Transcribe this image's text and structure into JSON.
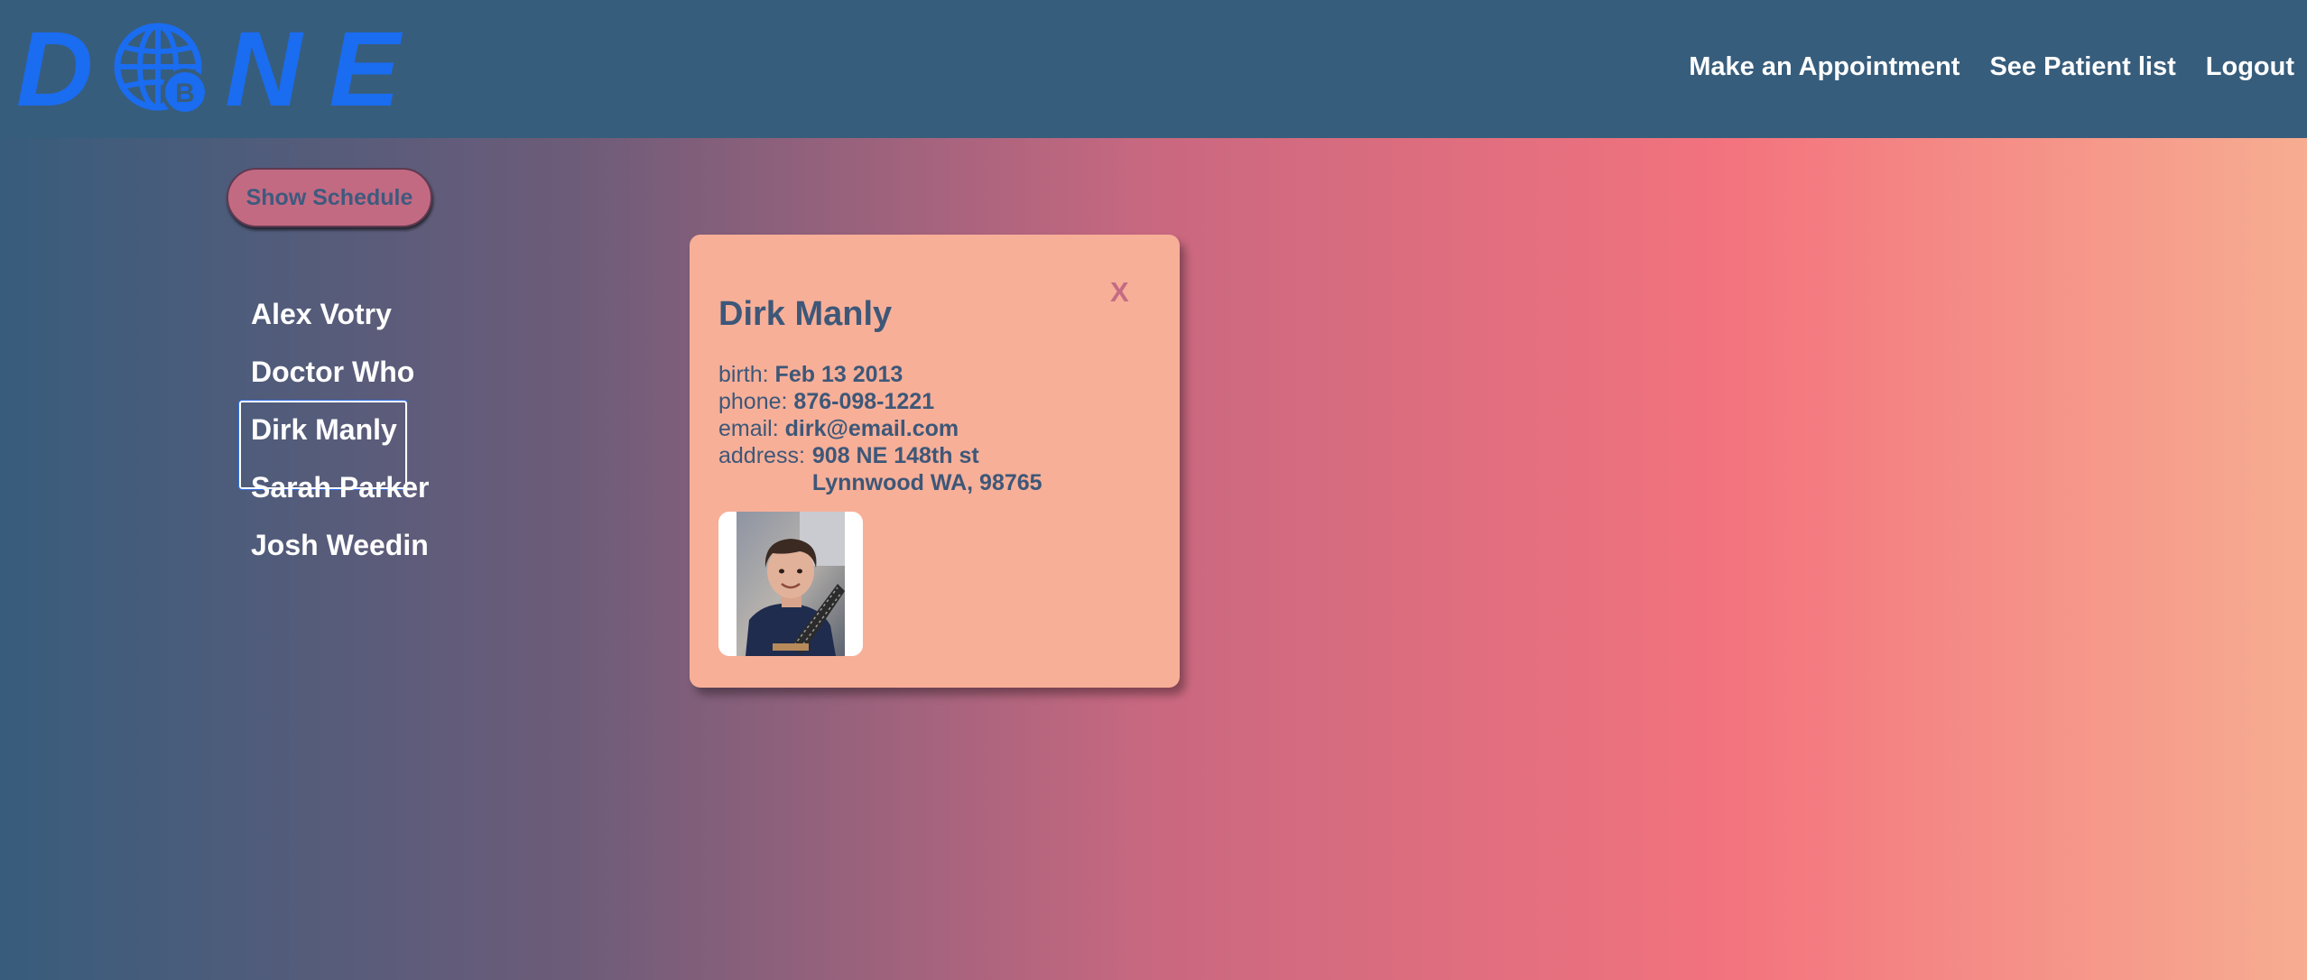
{
  "logo": {
    "letters": [
      "D",
      "N",
      "E"
    ],
    "globe_icon": "globe-bitcoin-icon",
    "brand_color": "#1a6cf0"
  },
  "nav": {
    "items": [
      "Make an Appointment",
      "See Patient list",
      "Logout"
    ]
  },
  "schedule_button": {
    "label": "Show Schedule"
  },
  "patients": [
    {
      "name": "Alex Votry"
    },
    {
      "name": "Doctor Who"
    },
    {
      "name": "Dirk Manly",
      "selected": true
    },
    {
      "name": "Sarah Parker"
    },
    {
      "name": "Josh Weedin"
    }
  ],
  "card": {
    "close_label": "X",
    "name": "Dirk Manly",
    "birth_label": "birth:",
    "birth": "Feb 13 2013",
    "phone_label": "phone:",
    "phone": "876-098-1221",
    "email_label": "email:",
    "email": "dirk@email.com",
    "address_label": "address:",
    "address_line1": "908 NE 148th st",
    "address_line2": "Lynnwood WA, 98765"
  },
  "colors": {
    "header_bg": "#375d7c",
    "card_bg": "#f7af98",
    "text_dark": "#3d5778",
    "accent_pink": "#c36a83"
  }
}
